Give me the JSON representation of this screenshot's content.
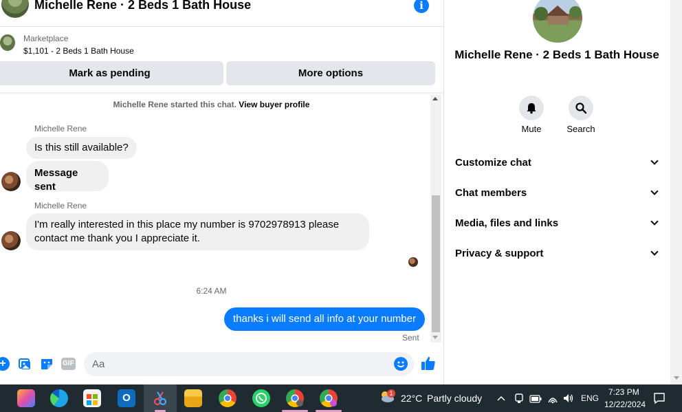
{
  "header": {
    "title": "Michelle Rene · 2 Beds 1 Bath House",
    "info_icon": "info-icon"
  },
  "marketplace": {
    "label": "Marketplace",
    "listing": "$1,101 - 2 Beds 1 Bath House",
    "mark_pending_label": "Mark as pending",
    "more_options_label": "More options"
  },
  "conversation": {
    "started_text": "Michelle Rene started this chat.",
    "view_profile_label": "View buyer profile",
    "groups": [
      {
        "sender": "Michelle Rene",
        "messages": [
          "Is this still available?",
          "Message sent"
        ]
      },
      {
        "sender": "Michelle Rene",
        "messages": [
          "I'm really interested in this place my number is 9702978913 please contact me thank you I appreciate it."
        ]
      }
    ],
    "timestamp": "6:24 AM",
    "outgoing": "thanks i will send all info at your number",
    "status": "Sent"
  },
  "composer": {
    "placeholder": "Aa",
    "gif_label": "GIF",
    "icons": [
      "plus-icon",
      "image-icon",
      "sticker-icon",
      "gif-icon",
      "emoji-icon",
      "like-icon"
    ]
  },
  "details_panel": {
    "title": "Michelle Rene · 2 Beds 1 Bath House",
    "actions": [
      {
        "label": "Mute",
        "icon": "bell-icon"
      },
      {
        "label": "Search",
        "icon": "search-icon"
      }
    ],
    "sections": [
      "Customize chat",
      "Chat members",
      "Media, files and links",
      "Privacy & support"
    ]
  },
  "taskbar": {
    "weather_temp": "22°C",
    "weather_desc": "Partly cloudy",
    "weather_badge": "1",
    "language": "ENG",
    "time": "7:23 PM",
    "date": "12/22/2024",
    "apps": [
      "copilot-icon",
      "edge-icon",
      "store-icon",
      "outlook-icon",
      "snipping-tool-icon",
      "file-explorer-icon",
      "chrome-icon",
      "whatsapp-icon",
      "chrome-profile-icon",
      "chrome-profile-2-icon"
    ]
  },
  "colors": {
    "accent": "#0a7cff",
    "bubble_incoming": "#f0f0f0",
    "taskbar_bg": "#1f2a31"
  }
}
